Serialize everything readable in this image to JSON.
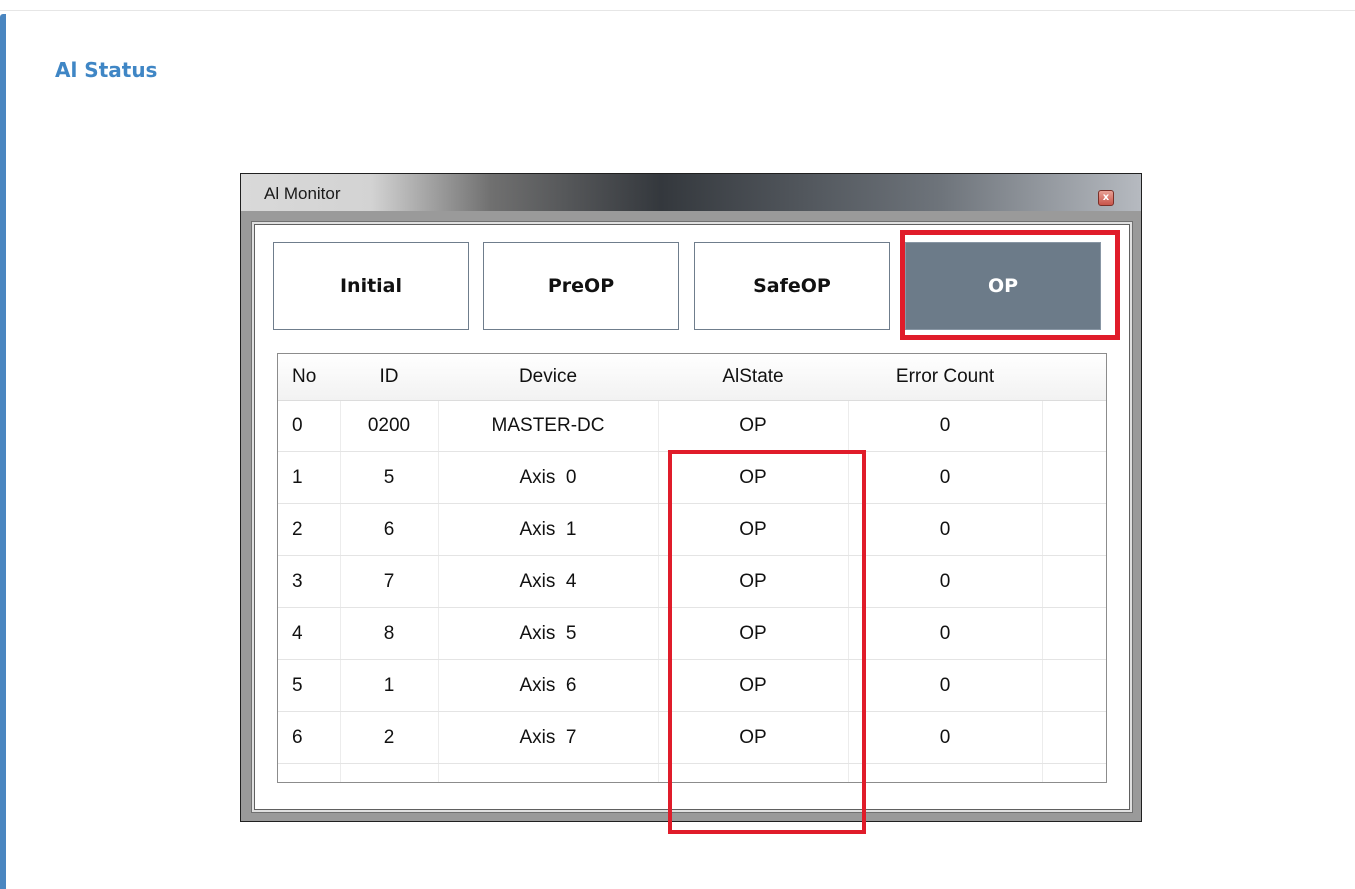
{
  "section": {
    "title": "Al Status"
  },
  "window": {
    "title": "Al Monitor",
    "close_glyph": "x"
  },
  "state_buttons": [
    {
      "label": "Initial",
      "active": false
    },
    {
      "label": "PreOP",
      "active": false
    },
    {
      "label": "SafeOP",
      "active": false
    },
    {
      "label": "OP",
      "active": true
    }
  ],
  "table": {
    "columns": [
      "No",
      "ID",
      "Device",
      "AlState",
      "Error Count"
    ],
    "rows": [
      {
        "no": "0",
        "id": "0200",
        "device": "MASTER-DC",
        "state": "OP",
        "errors": "0"
      },
      {
        "no": "1",
        "id": "5",
        "device": "Axis  0",
        "state": "OP",
        "errors": "0"
      },
      {
        "no": "2",
        "id": "6",
        "device": "Axis  1",
        "state": "OP",
        "errors": "0"
      },
      {
        "no": "3",
        "id": "7",
        "device": "Axis  4",
        "state": "OP",
        "errors": "0"
      },
      {
        "no": "4",
        "id": "8",
        "device": "Axis  5",
        "state": "OP",
        "errors": "0"
      },
      {
        "no": "5",
        "id": "1",
        "device": "Axis  6",
        "state": "OP",
        "errors": "0"
      },
      {
        "no": "6",
        "id": "2",
        "device": "Axis  7",
        "state": "OP",
        "errors": "0"
      }
    ]
  },
  "colors": {
    "accent": "#3f86c5",
    "highlight": "#e01c2a",
    "active_button": "#6c7b89"
  },
  "icons": {
    "close": "close-icon"
  }
}
